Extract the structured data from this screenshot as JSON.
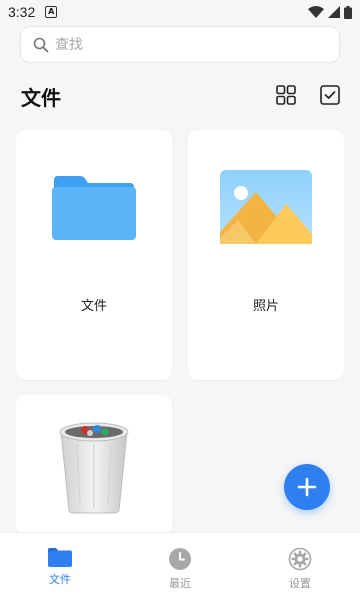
{
  "status_bar": {
    "time": "3:32",
    "notification_glyph": "A"
  },
  "search": {
    "placeholder": "查找"
  },
  "header": {
    "title": "文件"
  },
  "cards": [
    {
      "label": "文件",
      "icon": "folder-icon"
    },
    {
      "label": "照片",
      "icon": "photo-icon"
    },
    {
      "label": "",
      "icon": "trash-icon"
    }
  ],
  "bottom_nav": {
    "items": [
      {
        "label": "文件",
        "icon": "folder-icon",
        "active": true
      },
      {
        "label": "最近",
        "icon": "clock-icon",
        "active": false
      },
      {
        "label": "设置",
        "icon": "gear-icon",
        "active": false
      }
    ]
  },
  "colors": {
    "accent": "#2f7ff0",
    "folder": "#5ab4f5",
    "inactive": "#9a9a9a"
  }
}
